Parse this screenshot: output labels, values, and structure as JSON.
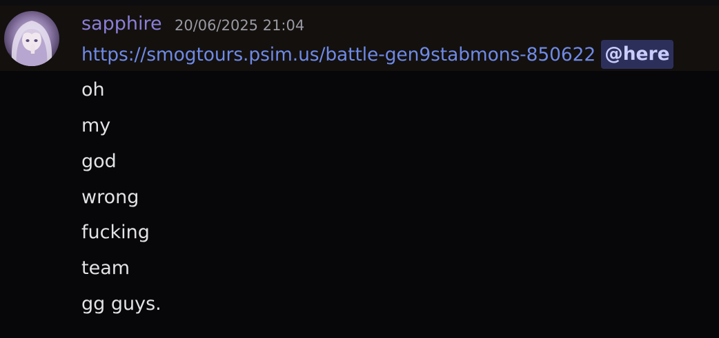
{
  "message": {
    "username": "sapphire",
    "timestamp": "20/06/2025 21:04",
    "link": "https://smogtours.psim.us/battle-gen9stabmons-850622",
    "mention": "@here",
    "lines": [
      "oh",
      "my",
      "god",
      "wrong",
      "fucking",
      "team",
      "gg guys."
    ]
  },
  "colors": {
    "username": "#8b7fd6",
    "link": "#6f8ae6",
    "mention_text": "#c9cdfb",
    "mention_bg": "#2d2f5b",
    "timestamp": "#9a9aa2",
    "text": "#e2e3e6",
    "background": "#070709",
    "highlight_row": "#13100e"
  },
  "avatar": {
    "icon": "avatar-anime-girl"
  }
}
